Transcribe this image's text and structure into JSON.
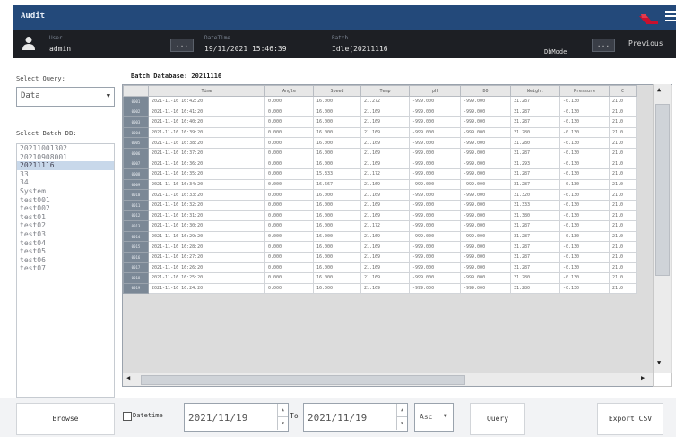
{
  "window": {
    "title": "Audit"
  },
  "infobar": {
    "user_label": "User",
    "user_value": "admin",
    "datetime_label": "DateTime",
    "datetime_value": "19/11/2021 15:46:39",
    "batch_label": "Batch",
    "batch_value": "Idle(20211116",
    "status_label": "DbMode",
    "previous_label": "Previous",
    "dots": "..."
  },
  "left": {
    "select_query_label": "Select Query:",
    "query_value": "Data",
    "select_batch_label": "Select Batch DB:",
    "batches": [
      "20211001302",
      "20210908001",
      "20211116",
      "33",
      "34",
      "System",
      "test001",
      "test002",
      "test01",
      "test02",
      "test03",
      "test04",
      "test05",
      "test06",
      "test07"
    ],
    "selected_batch": "20211116"
  },
  "table": {
    "title": "Batch Database: 20211116",
    "columns": [
      "Time",
      "Angle",
      "Speed",
      "Temp",
      "pH",
      "DO",
      "Weight",
      "Pressure",
      "C"
    ],
    "rows": [
      {
        "id": "0001",
        "cells": [
          "2021-11-16 16:42:20",
          "0.000",
          "16.000",
          "21.272",
          "-999.000",
          "-999.000",
          "31.287",
          "-0.130",
          "21.0"
        ]
      },
      {
        "id": "0002",
        "cells": [
          "2021-11-16 16:41:20",
          "0.000",
          "16.000",
          "21.169",
          "-999.000",
          "-999.000",
          "31.287",
          "-0.130",
          "21.0"
        ]
      },
      {
        "id": "0003",
        "cells": [
          "2021-11-16 16:40:20",
          "0.000",
          "16.000",
          "21.169",
          "-999.000",
          "-999.000",
          "31.287",
          "-0.130",
          "21.0"
        ]
      },
      {
        "id": "0004",
        "cells": [
          "2021-11-16 16:39:20",
          "0.000",
          "16.000",
          "21.169",
          "-999.000",
          "-999.000",
          "31.280",
          "-0.130",
          "21.0"
        ]
      },
      {
        "id": "0005",
        "cells": [
          "2021-11-16 16:38:20",
          "0.000",
          "16.000",
          "21.169",
          "-999.000",
          "-999.000",
          "31.280",
          "-0.130",
          "21.0"
        ]
      },
      {
        "id": "0006",
        "cells": [
          "2021-11-16 16:37:20",
          "0.000",
          "16.000",
          "21.169",
          "-999.000",
          "-999.000",
          "31.287",
          "-0.130",
          "21.0"
        ]
      },
      {
        "id": "0007",
        "cells": [
          "2021-11-16 16:36:20",
          "0.000",
          "16.000",
          "21.169",
          "-999.000",
          "-999.000",
          "31.293",
          "-0.130",
          "21.0"
        ]
      },
      {
        "id": "0008",
        "cells": [
          "2021-11-16 16:35:20",
          "0.000",
          "15.333",
          "21.172",
          "-999.000",
          "-999.000",
          "31.287",
          "-0.130",
          "21.0"
        ]
      },
      {
        "id": "0009",
        "cells": [
          "2021-11-16 16:34:20",
          "0.000",
          "16.667",
          "21.169",
          "-999.000",
          "-999.000",
          "31.287",
          "-0.130",
          "21.0"
        ]
      },
      {
        "id": "0010",
        "cells": [
          "2021-11-16 16:33:20",
          "0.000",
          "16.000",
          "21.169",
          "-999.000",
          "-999.000",
          "31.320",
          "-0.130",
          "21.0"
        ]
      },
      {
        "id": "0011",
        "cells": [
          "2021-11-16 16:32:20",
          "0.000",
          "16.000",
          "21.169",
          "-999.000",
          "-999.000",
          "31.333",
          "-0.130",
          "21.0"
        ]
      },
      {
        "id": "0012",
        "cells": [
          "2021-11-16 16:31:20",
          "0.000",
          "16.000",
          "21.169",
          "-999.000",
          "-999.000",
          "31.380",
          "-0.130",
          "21.0"
        ]
      },
      {
        "id": "0013",
        "cells": [
          "2021-11-16 16:30:20",
          "0.000",
          "16.000",
          "21.172",
          "-999.000",
          "-999.000",
          "31.287",
          "-0.130",
          "21.0"
        ]
      },
      {
        "id": "0014",
        "cells": [
          "2021-11-16 16:29:20",
          "0.000",
          "16.000",
          "21.169",
          "-999.000",
          "-999.000",
          "31.287",
          "-0.130",
          "21.0"
        ]
      },
      {
        "id": "0015",
        "cells": [
          "2021-11-16 16:28:20",
          "0.000",
          "16.000",
          "21.169",
          "-999.000",
          "-999.000",
          "31.287",
          "-0.130",
          "21.0"
        ]
      },
      {
        "id": "0016",
        "cells": [
          "2021-11-16 16:27:20",
          "0.000",
          "16.000",
          "21.169",
          "-999.000",
          "-999.000",
          "31.287",
          "-0.130",
          "21.0"
        ]
      },
      {
        "id": "0017",
        "cells": [
          "2021-11-16 16:26:20",
          "0.000",
          "16.000",
          "21.169",
          "-999.000",
          "-999.000",
          "31.287",
          "-0.130",
          "21.0"
        ]
      },
      {
        "id": "0018",
        "cells": [
          "2021-11-16 16:25:20",
          "0.000",
          "16.000",
          "21.169",
          "-999.000",
          "-999.000",
          "31.280",
          "-0.130",
          "21.0"
        ]
      },
      {
        "id": "0019",
        "cells": [
          "2021-11-16 16:24:20",
          "0.000",
          "16.000",
          "21.169",
          "-999.000",
          "-999.000",
          "31.280",
          "-0.130",
          "21.0"
        ]
      }
    ]
  },
  "bottom": {
    "browse_label": "Browse",
    "datetime_check_label": "Datetime",
    "from_date": "2021/11/19",
    "to_label": "To",
    "to_date": "2021/11/19",
    "order_value": "Asc",
    "query_label": "Query",
    "export_label": "Export CSV"
  },
  "colors": {
    "titlebar": "#23497a",
    "infobar": "#1d1f24",
    "selected_row": "#c8d8ea",
    "row_header": "#7b8896"
  },
  "icons": [
    "user-icon",
    "logo-icon",
    "menu-icon",
    "scroll-up-icon",
    "scroll-down-icon",
    "scroll-left-icon",
    "scroll-right-icon",
    "chevron-down-icon",
    "spin-up-icon",
    "spin-down-icon"
  ]
}
